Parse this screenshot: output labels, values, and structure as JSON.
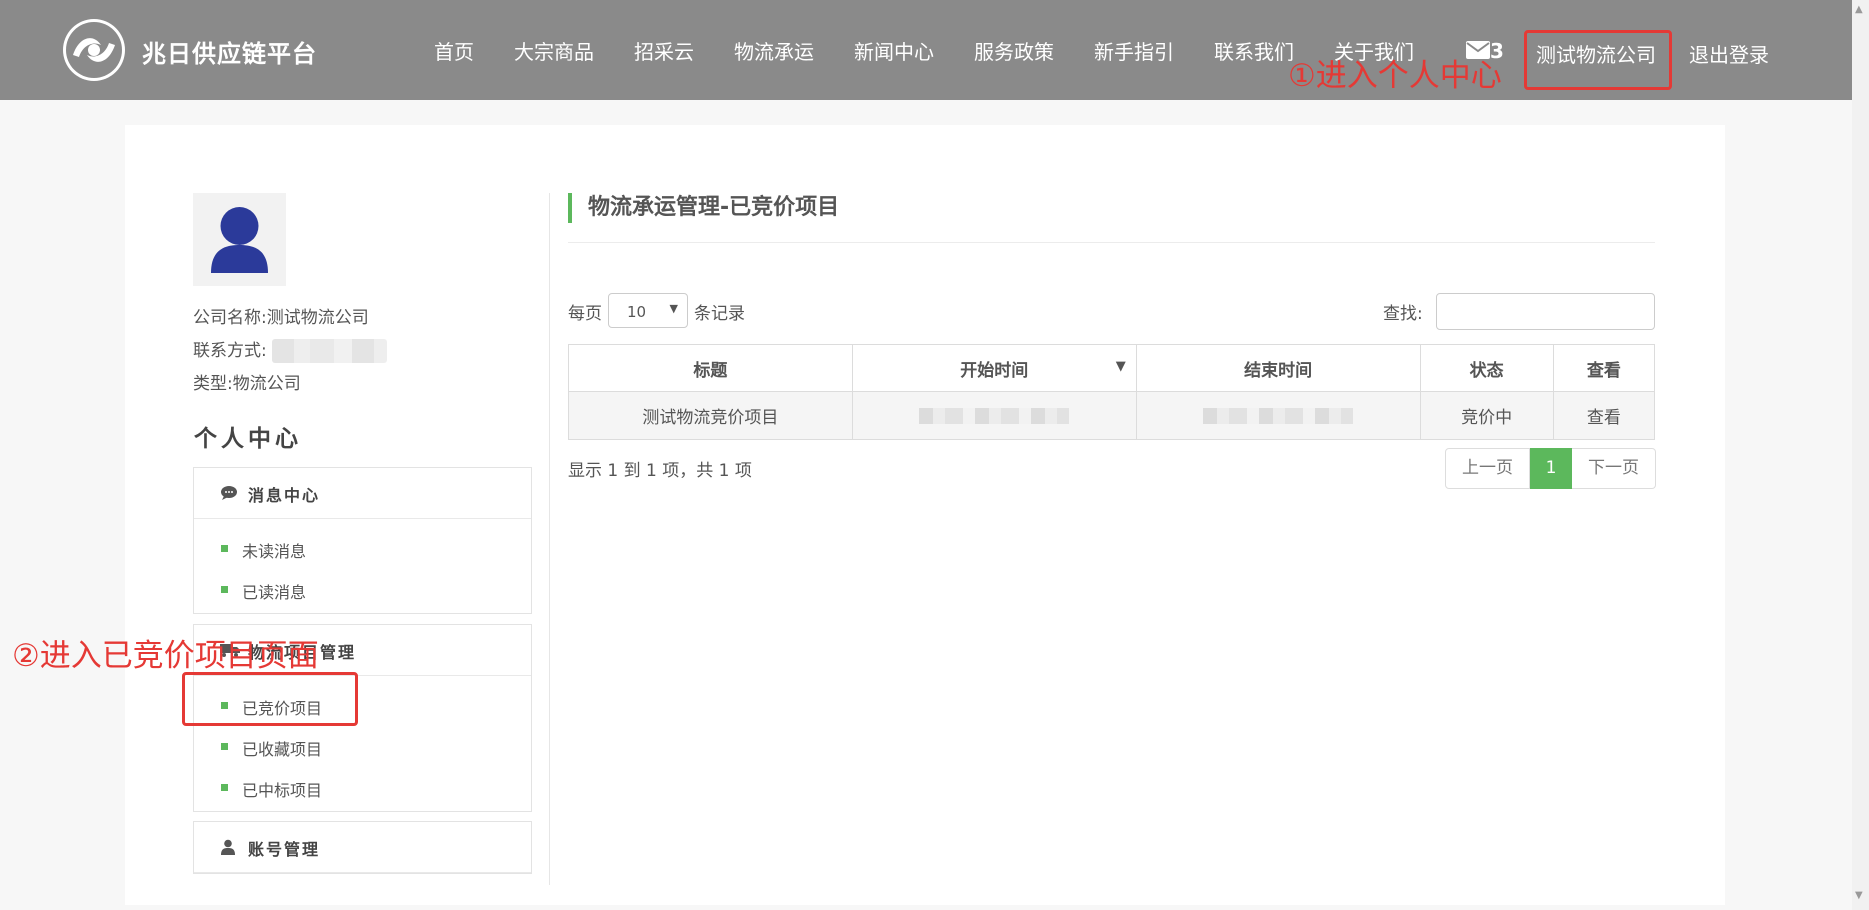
{
  "header": {
    "brand": "兆日供应链平台",
    "nav": [
      "首页",
      "大宗商品",
      "招采云",
      "物流承运",
      "新闻中心",
      "服务政策",
      "新手指引",
      "联系我们",
      "关于我们"
    ],
    "mail_count": "3",
    "company_link": "测试物流公司",
    "logout": "退出登录"
  },
  "annotations": {
    "step1": "①进入个人中心",
    "step2": "②进入已竞价项目页面",
    "color": "#e53935"
  },
  "profile": {
    "company_label": "公司名称:",
    "company_value": "测试物流公司",
    "contact_label": "联系方式:",
    "type_label": "类型:",
    "type_value": "物流公司"
  },
  "sidebar": {
    "title": "个人中心",
    "sections": [
      {
        "title": "消息中心",
        "icon": "chat-bubble-icon",
        "items": [
          "未读消息",
          "已读消息"
        ]
      },
      {
        "title": "物流项目管理",
        "icon": "truck-icon",
        "items": [
          "已竞价项目",
          "已收藏项目",
          "已中标项目"
        ]
      },
      {
        "title": "账号管理",
        "icon": "user-icon",
        "items": []
      }
    ]
  },
  "content": {
    "title": "物流承运管理-已竞价项目",
    "per_page_label": "每页",
    "per_page_value": "10",
    "records_label": "条记录",
    "search_label": "查找:",
    "search_value": "",
    "columns": [
      "标题",
      "开始时间",
      "结束时间",
      "状态",
      "查看"
    ],
    "rows": [
      {
        "title": "测试物流竞价项目",
        "status": "竞价中",
        "action": "查看"
      }
    ],
    "summary": "显示 1 到 1 项，共 1 项",
    "pager": {
      "prev": "上一页",
      "current": "1",
      "next": "下一页"
    }
  },
  "colors": {
    "header_bg": "#8a8a8a",
    "accent": "#5cb85c",
    "annotation": "#e53935"
  }
}
